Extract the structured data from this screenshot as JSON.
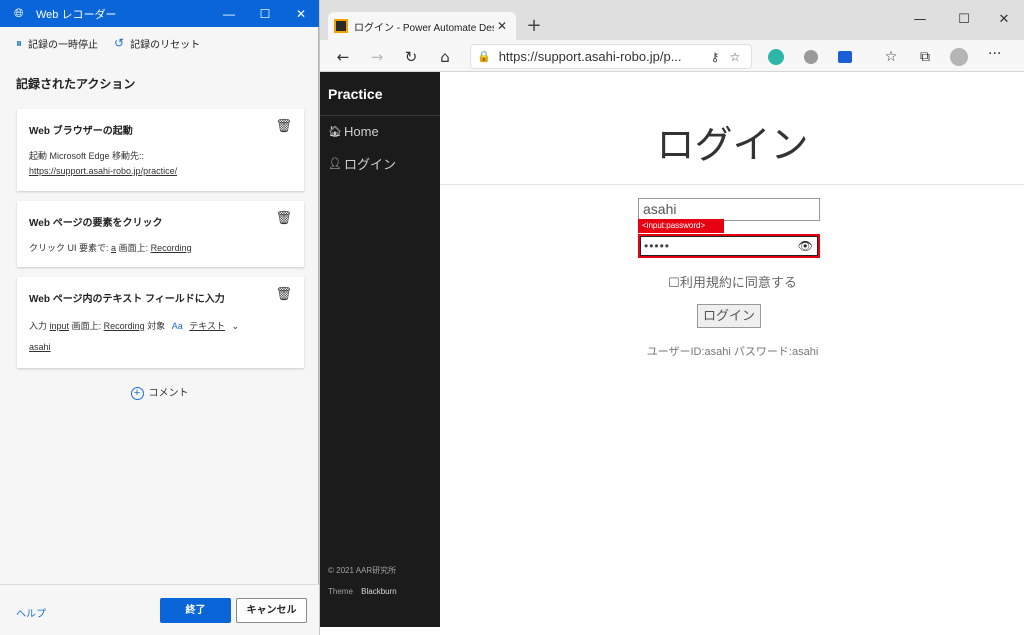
{
  "recorder": {
    "title": "Web レコーダー",
    "window_controls": {
      "minimize": "—",
      "maximize": "☐",
      "close": "✕"
    },
    "toolbar": {
      "pause_label": "記録の一時停止",
      "reset_label": "記録のリセット"
    },
    "heading": "記録されたアクション",
    "actions": [
      {
        "title": "Web ブラウザーの起動",
        "line1": "起動 Microsoft Edge 移動先::",
        "line2": "https://support.asahi-robo.jp/practice/"
      },
      {
        "title": "Web ページの要素をクリック",
        "prefix": "クリック UI 要素で:",
        "element": "a",
        "screen_label": "画面上:",
        "screen": "Recording"
      },
      {
        "title": "Web ページ内のテキスト フィールドに入力",
        "prefix": "入力",
        "element": "input",
        "screen_label": "画面上:",
        "screen": "Recording",
        "target_label": "対象",
        "aa": "Aa",
        "mode": "テキスト",
        "value": "asahi"
      }
    ],
    "comment_label": "コメント",
    "footer": {
      "help": "ヘルプ",
      "finish": "終了",
      "cancel": "キャンセル"
    }
  },
  "browser": {
    "tab_title": "ログイン - Power Automate Deskto",
    "new_tab": "+",
    "window_controls": {
      "minimize": "—",
      "maximize": "☐",
      "close": "✕"
    },
    "url": "https://support.asahi-robo.jp/p...",
    "site": {
      "brand": "Practice",
      "nav": [
        {
          "icon": "home-icon",
          "label": "Home"
        },
        {
          "icon": "user-icon",
          "label": "ログイン"
        }
      ],
      "footer_copyright": "© 2021   AAR研究所",
      "footer_theme_label": "Theme",
      "footer_theme": "Blackburn",
      "page_title": "ログイン",
      "username_value": "asahi",
      "password_tag": "<input:password>",
      "password_value": "•••••",
      "agree_label": "☐利用規約に同意する",
      "login_button": "ログイン",
      "hint": "ユーザーID:asahi パスワード:asahi"
    }
  },
  "colors": {
    "recorder_accent": "#0a66d8",
    "highlight_red": "#e60012",
    "site_sidebar": "#1b1b1b"
  }
}
